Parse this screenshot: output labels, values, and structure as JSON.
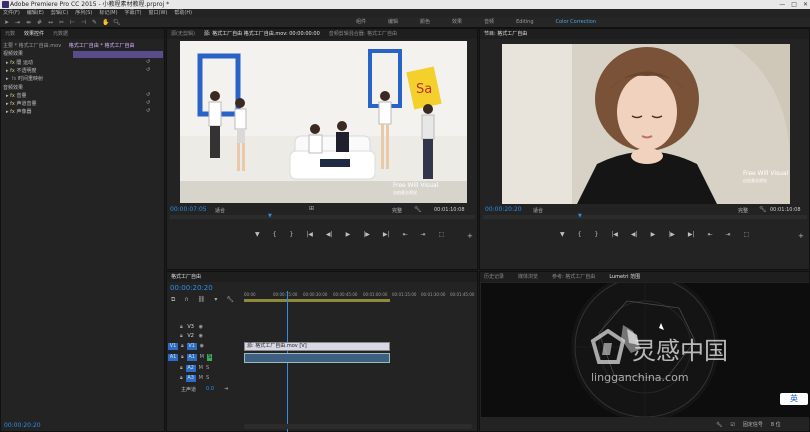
{
  "title_bar": {
    "text": "Adobe Premiere Pro CC 2015 - 小教程素材教程.prproj *",
    "buttons": [
      "—",
      "□",
      "✕"
    ]
  },
  "menu": [
    "文件(F)",
    "编辑(E)",
    "剪辑(C)",
    "序列(S)",
    "标记(M)",
    "字幕(T)",
    "窗口(W)",
    "帮助(H)"
  ],
  "tools": [
    "selection-tool",
    "track-select-tool",
    "ripple-tool",
    "rolling-tool",
    "rate-tool",
    "razor-tool",
    "slip-tool",
    "slide-tool",
    "pen-tool",
    "hand-tool",
    "zoom-tool"
  ],
  "workspaces": [
    {
      "label": "组件",
      "active": false
    },
    {
      "label": "编辑",
      "active": false
    },
    {
      "label": "颜色",
      "active": false
    },
    {
      "label": "效果",
      "active": false
    },
    {
      "label": "音频",
      "active": false
    },
    {
      "label": "Editing",
      "active": false
    },
    {
      "label": "Color Correction",
      "active": true
    }
  ],
  "effect_controls": {
    "tabs": [
      "元数",
      "效果控件",
      "元数据"
    ],
    "header": "主要 * 格式工厂自由.mov",
    "header_clip": "格式工厂自由 * 格式工厂自由",
    "video_section": "视频效果",
    "video_effects": [
      "运动",
      "不透明度",
      "时间重映射"
    ],
    "audio_section": "音频效果",
    "audio_effects": [
      "音量",
      "声道音量",
      "声像器"
    ],
    "timecode": "00:00:20:20"
  },
  "source_monitor": {
    "tabs": [
      "源(无剪辑)",
      "源: 格式工厂自由 格式工厂自由.mov: 00:00:00:00",
      "音频剪辑混合器: 格式工厂自由"
    ],
    "timecode": "00:00:07:05",
    "zoom": "适合",
    "quality": "完整",
    "duration": "00:01:10:08",
    "watermark": "Free Will Visual",
    "watermark_sub": "自由意志视觉",
    "sign_text": "Sa"
  },
  "program_monitor": {
    "tab": "节目: 格式工厂自由",
    "timecode": "00:00:20:20",
    "zoom": "适合",
    "quality": "完整",
    "duration": "00:01:10:08",
    "watermark": "Free Will Visual",
    "watermark_sub": "自由意志视觉"
  },
  "transport_controls": [
    "▼",
    "{",
    "}",
    "|◀",
    "◀|",
    "▶",
    "|▶",
    "▶|",
    "⇤",
    "⇥",
    "⬚"
  ],
  "timeline": {
    "tab": "格式工厂自由",
    "timecode": "00:00:20:20",
    "ruler": [
      "00:00",
      "00:00:15:00",
      "00:00:30:00",
      "00:00:45:00",
      "00:01:00:00",
      "00:01:15:00",
      "00:01:30:00",
      "00:01:45:00"
    ],
    "video_tracks": [
      "V3",
      "V2",
      "V1"
    ],
    "audio_tracks": [
      "A1",
      "A2",
      "A3"
    ],
    "master": "主声道",
    "master_value": "0.0",
    "video_clip": "源: 格式工厂自由.mov [V]",
    "audio_clip": ""
  },
  "lumetri": {
    "tabs": [
      "历史记录",
      "媒体浏览",
      "参考: 格式工厂自由",
      "Lumetri 范围"
    ],
    "footer_label": "固定信号",
    "footer_value": "8 位"
  },
  "colors": {
    "accent": "#2e8ee6",
    "panel": "#232323",
    "dark": "#1a1a1a",
    "track_on": "#2b6cc4",
    "clip_video": "#d7d7e6",
    "clip_audio": "#3e5f82"
  },
  "site_watermark": {
    "brand": "灵感中国",
    "url": "lingganchina.com"
  },
  "ime": {
    "label": "英"
  }
}
